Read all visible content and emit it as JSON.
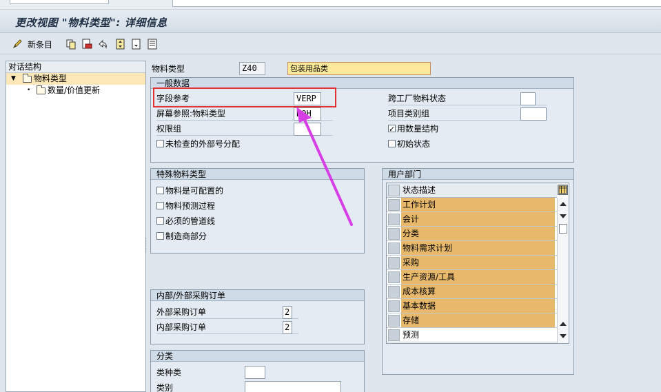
{
  "window": {
    "title": "更改视图 \"物料类型\": 详细信息"
  },
  "toolbar": {
    "new_entries_label": "新条目",
    "icons": [
      "edit-pencil-icon",
      "copy-icon",
      "delete-icon",
      "undo-icon",
      "previous-entry-icon",
      "next-entry-icon",
      "select-all-icon"
    ]
  },
  "nav": {
    "header": "对话结构",
    "items": [
      {
        "label": "物料类型",
        "selected": true,
        "level": 0
      },
      {
        "label": "数量/价值更新",
        "selected": false,
        "level": 1
      }
    ]
  },
  "material_type": {
    "label": "物料类型",
    "code": "Z40",
    "description": "包装用品类"
  },
  "general": {
    "header": "一般数据",
    "field_reference_label": "字段参考",
    "field_reference_value": "VERP",
    "screen_reference_label": "屏幕参照:物料类型",
    "screen_reference_value": "ROH",
    "auth_group_label": "权限组",
    "auth_group_value": "",
    "ext_no_check_label": "未检查的外部号分配",
    "ext_no_check": false,
    "cross_plant_status_label": "跨工厂物料状态",
    "cross_plant_status_value": "",
    "item_category_group_label": "项目类别组",
    "item_category_group_value": "",
    "qty_structure_label": "用数量结构",
    "qty_structure": true,
    "initial_status_label": "初始状态",
    "initial_status": false
  },
  "special": {
    "header": "特殊物料类型",
    "items": [
      {
        "label": "物料是可配置的",
        "checked": false
      },
      {
        "label": "物料预测过程",
        "checked": false
      },
      {
        "label": "必须的管道线",
        "checked": false
      },
      {
        "label": "制造商部分",
        "checked": false
      }
    ]
  },
  "po": {
    "header": "内部/外部采购订单",
    "external_label": "外部采购订单",
    "external_value": "2",
    "internal_label": "内部采购订单",
    "internal_value": "2"
  },
  "classification": {
    "header": "分类",
    "class_type_label": "类种类",
    "class_type_value": "",
    "class_label": "类别",
    "class_value": ""
  },
  "user_departments": {
    "header": "用户部门",
    "column_header": "状态描述",
    "rows": [
      {
        "label": "工作计划",
        "highlighted": true
      },
      {
        "label": "会计",
        "highlighted": true
      },
      {
        "label": "分类",
        "highlighted": true
      },
      {
        "label": "物料需求计划",
        "highlighted": true
      },
      {
        "label": "采购",
        "highlighted": true
      },
      {
        "label": "生产资源/工具",
        "highlighted": true
      },
      {
        "label": "成本核算",
        "highlighted": true
      },
      {
        "label": "基本数据",
        "highlighted": true
      },
      {
        "label": "存储",
        "highlighted": true
      },
      {
        "label": "预测",
        "highlighted": false
      }
    ]
  },
  "colors": {
    "highlight_row": "#e8b96a",
    "description_field": "#fce99b",
    "annotation": "#e23333",
    "arrow": "#d63fe6"
  }
}
